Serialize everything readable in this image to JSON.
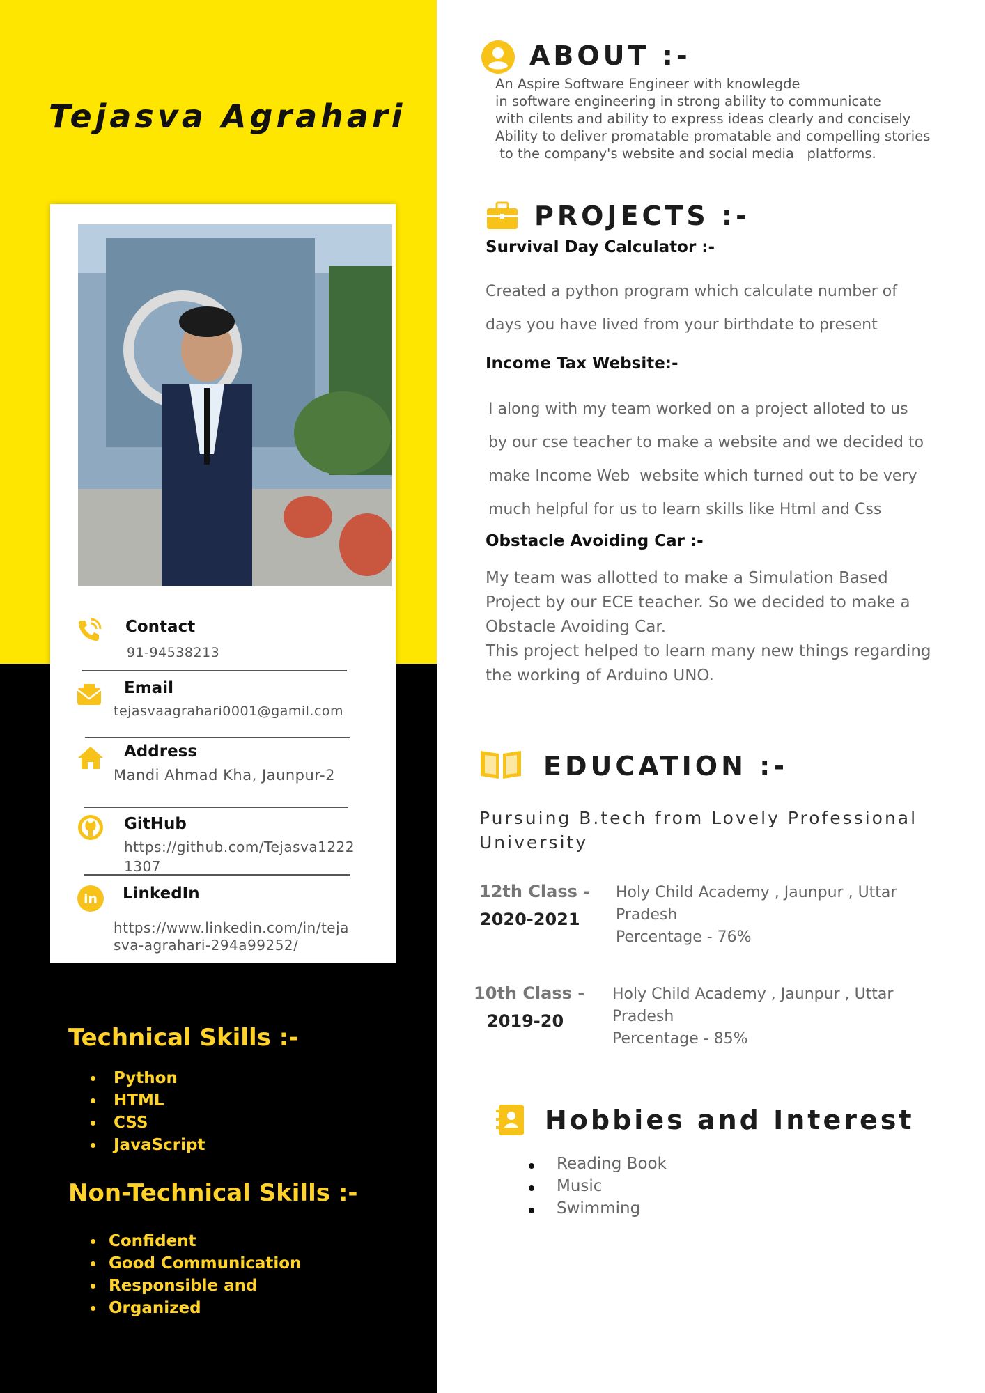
{
  "name": "Tejasva Agrahari",
  "contact": {
    "phone": {
      "title": "Contact",
      "value": "91-94538213"
    },
    "email": {
      "title": "Email",
      "value": "tejasvaagrahari0001@gamil.com"
    },
    "address": {
      "title": "Address",
      "value": "Mandi Ahmad Kha, Jaunpur-2"
    },
    "github": {
      "title": "GitHub",
      "value_line1": "https://github.com/Tejasva1222",
      "value_line2": "1307"
    },
    "linkedin": {
      "title": "LinkedIn",
      "value_line1": "https://www.linkedin.com/in/teja",
      "value_line2": "sva-agrahari-294a99252/"
    }
  },
  "technical_skills": {
    "title": "Technical Skills :-",
    "items": [
      "Python",
      "HTML",
      "CSS",
      "JavaScript"
    ]
  },
  "non_technical_skills": {
    "title": "Non-Technical Skills :-",
    "items": [
      "Confident",
      "Good Communication",
      "Responsible and",
      "Organized"
    ]
  },
  "about": {
    "title": "ABOUT :-",
    "lines": [
      "An Aspire Software Engineer with knowlegde",
      "in software engineering in strong ability to communicate",
      "with cilents and ability to express ideas  clearly and concisely",
      "Ability to deliver promatable promatable and compelling stories",
      " to the company's website and social media   platforms."
    ]
  },
  "projects": {
    "title": "PROJECTS :-",
    "items": [
      {
        "title": "Survival Day Calculator :-",
        "lines": [
          "Created a python program which calculate number of",
          "days you have lived from your birthdate to present"
        ]
      },
      {
        "title": "Income Tax Website:-",
        "lines": [
          "I along with my team worked on a project alloted to us",
          "by our cse teacher to make a website and we decided to",
          "make Income Web  website which turned out to be very",
          "much helpful for us to learn skills like Html and Css"
        ]
      },
      {
        "title": "Obstacle Avoiding Car :-",
        "lines": [
          "My team was allotted to make a Simulation Based",
          "Project by our ECE teacher. So we decided to make a",
          "Obstacle Avoiding Car.",
          "This project helped to learn many new things regarding",
          "the working of Arduino UNO."
        ]
      }
    ]
  },
  "education": {
    "title": "EDUCATION :-",
    "lead": "Pursuing B.tech from Lovely Professional University",
    "entries": [
      {
        "class": "12th Class -",
        "years": "2020-2021",
        "school": "Holy Child Academy , Jaunpur , Uttar",
        "state": "Pradesh",
        "percentage": "Percentage - 76%"
      },
      {
        "class": "10th Class -",
        "years": "2019-20",
        "school": "Holy Child Academy , Jaunpur , Uttar",
        "state": "Pradesh",
        "percentage": "Percentage - 85%"
      }
    ]
  },
  "hobbies": {
    "title": "Hobbies and Interest",
    "items": [
      "Reading Book",
      "Music",
      "Swimming"
    ]
  },
  "colors": {
    "accent_yellow": "#ffe600",
    "skills_yellow": "#ffd22a",
    "icon_yellow": "#f7c21a",
    "black": "#000000"
  },
  "icons": [
    "phone-icon",
    "email-icon",
    "home-icon",
    "github-icon",
    "linkedin-icon",
    "user-icon",
    "briefcase-icon",
    "book-icon",
    "contact-book-icon"
  ]
}
